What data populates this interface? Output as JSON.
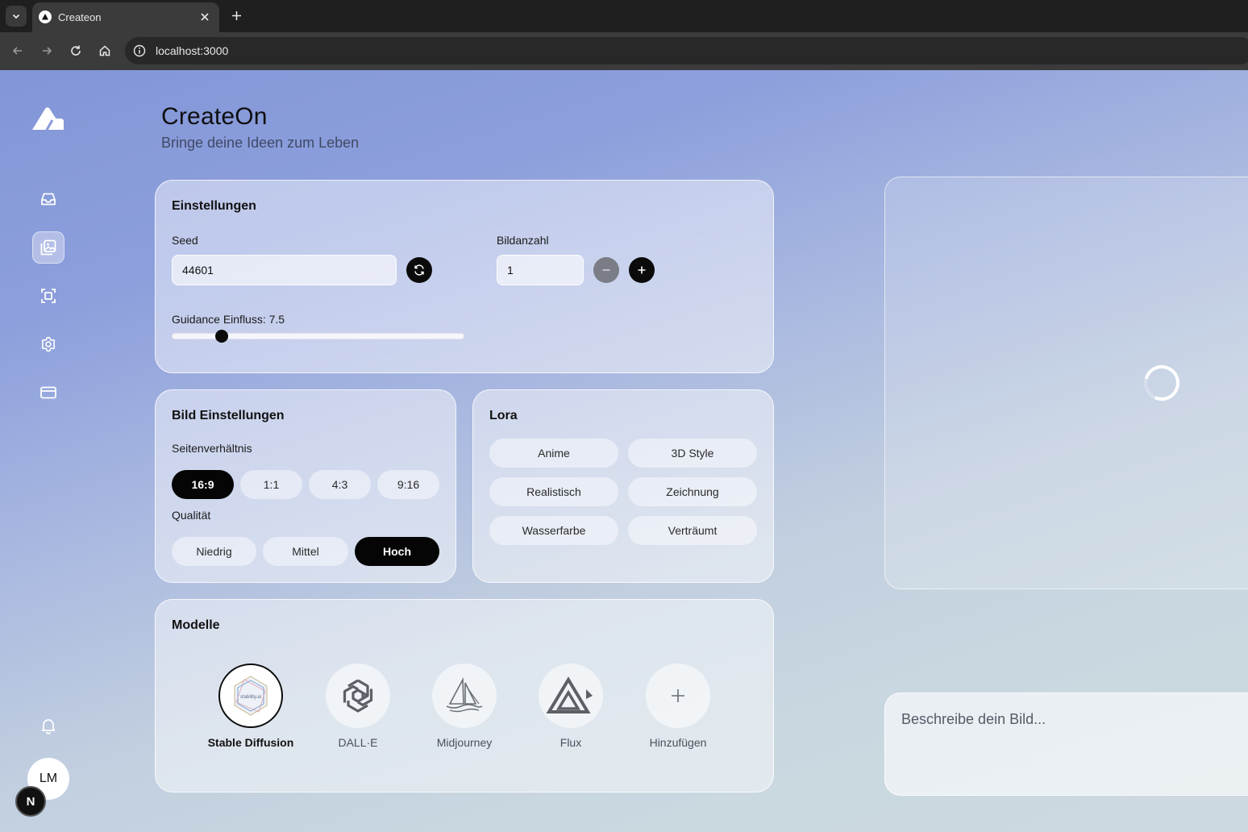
{
  "browser": {
    "tab_title": "Createon",
    "url": "localhost:3000"
  },
  "app": {
    "title": "CreateOn",
    "subtitle": "Bringe deine Ideen zum Leben",
    "sidebar": {
      "items": [
        {
          "icon": "inbox-icon",
          "active": false
        },
        {
          "icon": "gallery-icon",
          "active": true
        },
        {
          "icon": "scan-icon",
          "active": false
        },
        {
          "icon": "gear-icon",
          "active": false
        },
        {
          "icon": "credit-card-icon",
          "active": false
        }
      ],
      "notification_icon": "bell-icon",
      "avatar_initials": "LM",
      "dev_badge": "N"
    },
    "settings": {
      "title": "Einstellungen",
      "seed_label": "Seed",
      "seed_value": "44601",
      "count_label": "Bildanzahl",
      "count_value": "1",
      "guidance_label": "Guidance Einfluss: 7.5",
      "guidance_value": 7.5,
      "guidance_range": [
        0,
        50
      ]
    },
    "image_settings": {
      "title": "Bild Einstellungen",
      "aspect_label": "Seitenverhältnis",
      "aspect_options": [
        "16:9",
        "1:1",
        "4:3",
        "9:16"
      ],
      "aspect_selected": "16:9",
      "quality_label": "Qualität",
      "quality_options": [
        "Niedrig",
        "Mittel",
        "Hoch"
      ],
      "quality_selected": "Hoch"
    },
    "lora": {
      "title": "Lora",
      "options": [
        "Anime",
        "3D Style",
        "Realistisch",
        "Zeichnung",
        "Wasserfarbe",
        "Verträumt"
      ]
    },
    "models": {
      "title": "Modelle",
      "items": [
        {
          "label": "Stable Diffusion",
          "logo_text": "stability.ai",
          "selected": true
        },
        {
          "label": "DALL·E",
          "selected": false
        },
        {
          "label": "Midjourney",
          "selected": false
        },
        {
          "label": "Flux",
          "selected": false
        },
        {
          "label": "Hinzufügen",
          "selected": false
        }
      ]
    },
    "prompt": {
      "placeholder": "Beschreibe dein Bild..."
    }
  }
}
